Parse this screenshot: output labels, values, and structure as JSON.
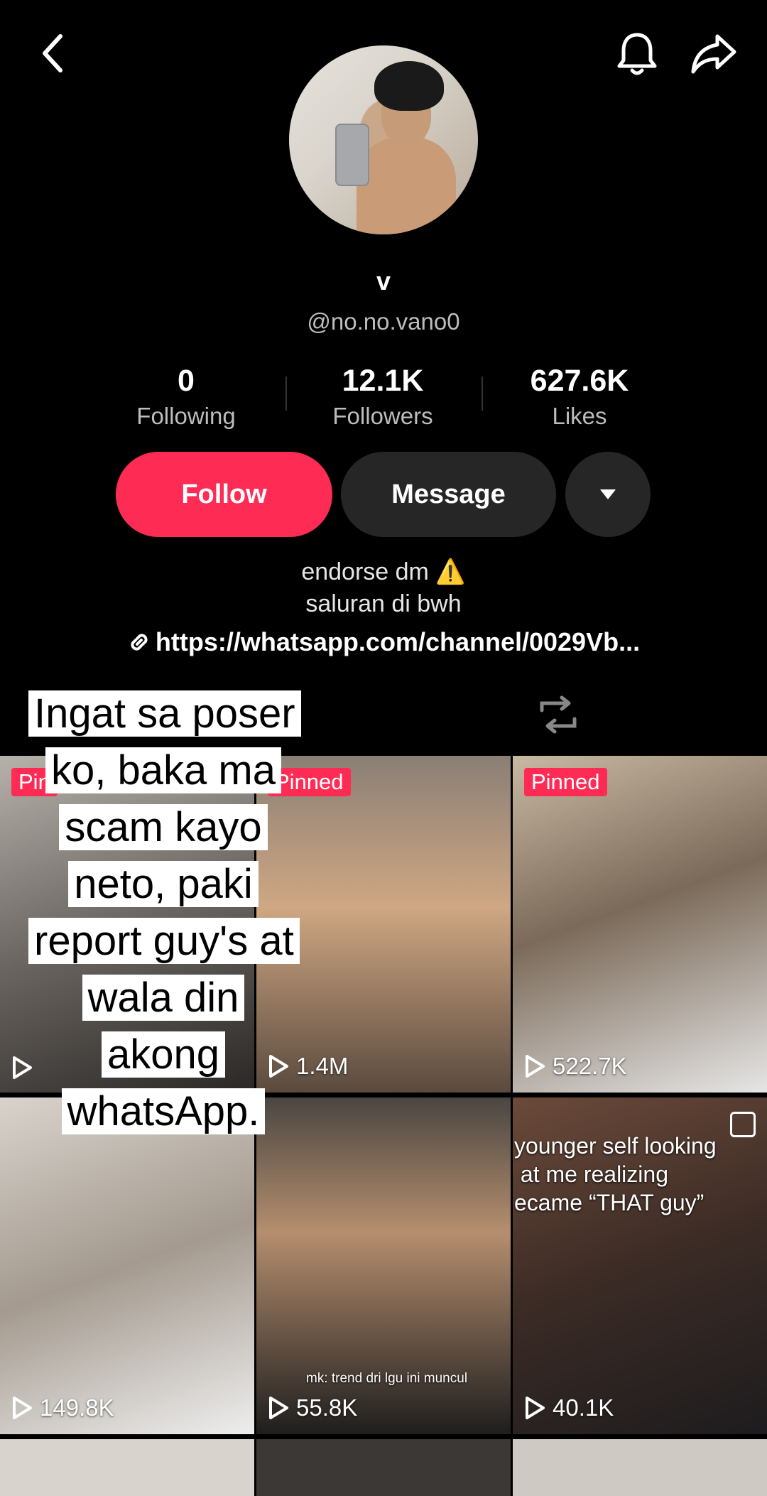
{
  "header": {
    "back_icon": "chevron-left-icon",
    "bell_icon": "bell-icon",
    "share_icon": "share-arrow-icon"
  },
  "profile": {
    "name": "v",
    "handle": "@no.no.vano0"
  },
  "stats": [
    {
      "num": "0",
      "label": "Following"
    },
    {
      "num": "12.1K",
      "label": "Followers"
    },
    {
      "num": "627.6K",
      "label": "Likes"
    }
  ],
  "actions": {
    "follow": "Follow",
    "message": "Message"
  },
  "bio": {
    "line1": "endorse dm ⚠️",
    "line2": "saluran di bwh",
    "link": "https://whatsapp.com/channel/0029Vb..."
  },
  "overlay_text": "Ingat sa poser ko, baka ma scam kayo neto, paki report guy's at wala din akong whatsApp.",
  "videos": [
    {
      "badge": "Pin",
      "views": ""
    },
    {
      "badge": "Pinned",
      "views": "1.4M"
    },
    {
      "badge": "Pinned",
      "views": "522.7K"
    },
    {
      "badge": "",
      "views": "149.8K"
    },
    {
      "badge": "",
      "views": "55.8K",
      "caption": "mk: trend dri lgu ini muncul"
    },
    {
      "badge": "",
      "views": "40.1K",
      "caption": "younger self looking\n at me realizing\necame “THAT guy”"
    }
  ],
  "colors": {
    "accent": "#fe2c55",
    "background": "#000000",
    "button_dark": "#262626"
  }
}
